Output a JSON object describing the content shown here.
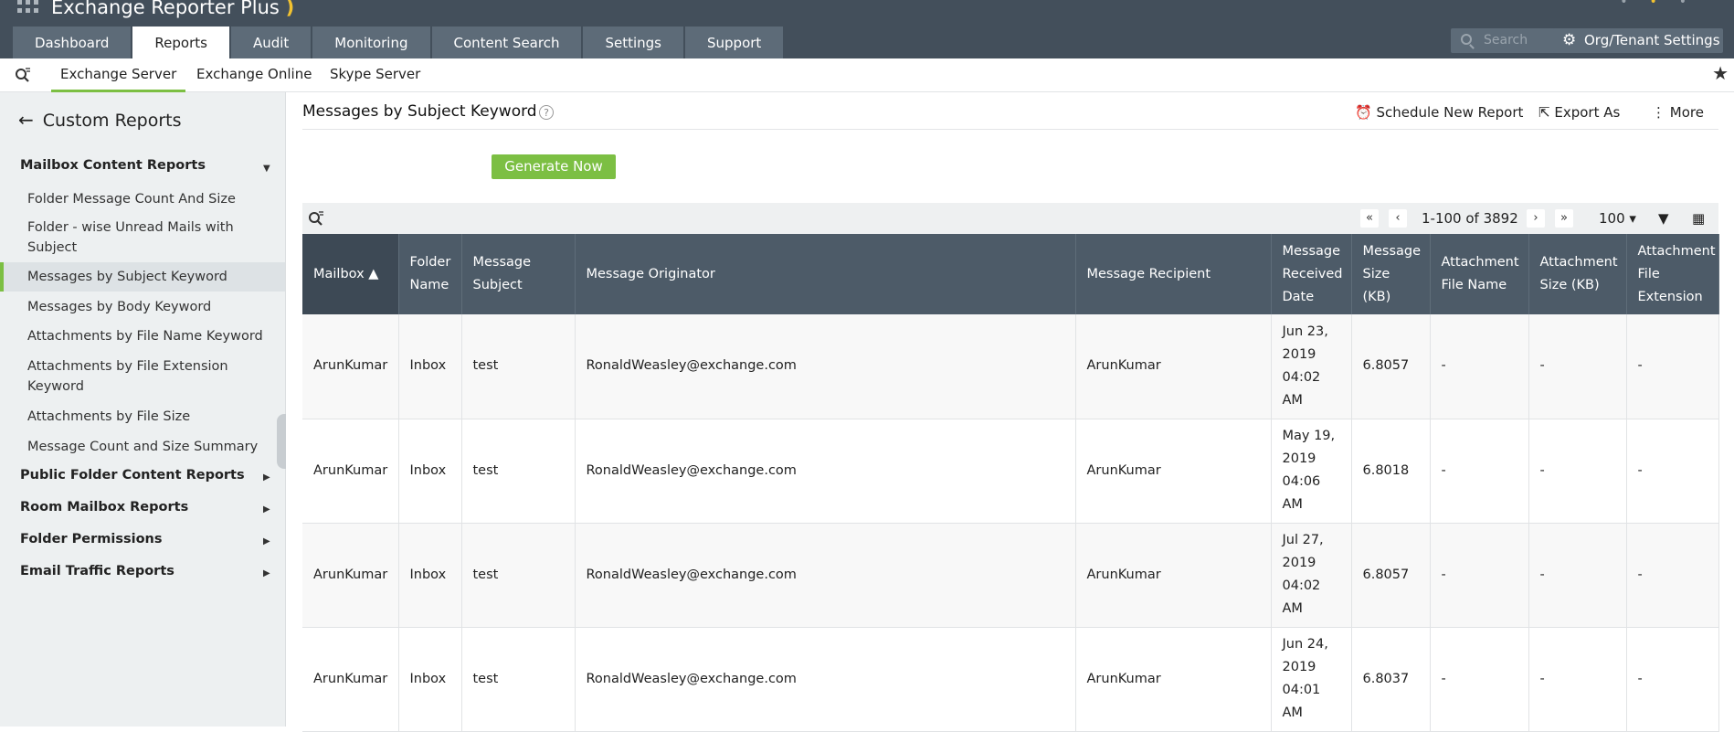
{
  "app": {
    "title": "Exchange Reporter Plus"
  },
  "top_tabs": [
    {
      "label": "Dashboard"
    },
    {
      "label": "Reports",
      "active": true
    },
    {
      "label": "Audit"
    },
    {
      "label": "Monitoring"
    },
    {
      "label": "Content Search"
    },
    {
      "label": "Settings"
    },
    {
      "label": "Support"
    }
  ],
  "header": {
    "search_placeholder": "Search",
    "org_settings_label": "Org/Tenant Settings"
  },
  "sub_tabs": [
    {
      "label": "Exchange Server",
      "active": true
    },
    {
      "label": "Exchange Online"
    },
    {
      "label": "Skype Server"
    }
  ],
  "sidebar": {
    "back_label": "Custom Reports",
    "category_expanded": "Mailbox Content Reports",
    "items": [
      {
        "label": "Folder Message Count And Size"
      },
      {
        "label": "Folder - wise Unread Mails with Subject"
      },
      {
        "label": "Messages by Subject Keyword",
        "active": true
      },
      {
        "label": "Messages by Body Keyword"
      },
      {
        "label": "Attachments by File Name Keyword"
      },
      {
        "label": "Attachments by File Extension Keyword"
      },
      {
        "label": "Attachments by File Size"
      },
      {
        "label": "Message Count and Size Summary"
      }
    ],
    "categories_collapsed": [
      {
        "label": "Public Folder Content Reports"
      },
      {
        "label": "Room Mailbox Reports"
      },
      {
        "label": "Folder Permissions"
      },
      {
        "label": "Email Traffic Reports"
      }
    ]
  },
  "report": {
    "title": "Messages by Subject Keyword",
    "actions": {
      "schedule": "Schedule New Report",
      "export": "Export As",
      "more": "More"
    },
    "generate_label": "Generate Now",
    "pager": {
      "range": "1-100 of 3892",
      "page_size": "100"
    },
    "columns": [
      "Mailbox",
      "Folder Name",
      "Message Subject",
      "Message Originator",
      "Message Recipient",
      "Message Received Date",
      "Message Size (KB)",
      "Attachment File Name",
      "Attachment Size (KB)",
      "Attachment File Extension"
    ],
    "rows": [
      [
        "ArunKumar",
        "Inbox",
        "test",
        "RonaldWeasley@exchange.com",
        "ArunKumar",
        "Jun 23, 2019 04:02 AM",
        "6.8057",
        "-",
        "-",
        "-"
      ],
      [
        "ArunKumar",
        "Inbox",
        "test",
        "RonaldWeasley@exchange.com",
        "ArunKumar",
        "May 19, 2019 04:06 AM",
        "6.8018",
        "-",
        "-",
        "-"
      ],
      [
        "ArunKumar",
        "Inbox",
        "test",
        "RonaldWeasley@exchange.com",
        "ArunKumar",
        "Jul 27, 2019 04:02 AM",
        "6.8057",
        "-",
        "-",
        "-"
      ],
      [
        "ArunKumar",
        "Inbox",
        "test",
        "RonaldWeasley@exchange.com",
        "ArunKumar",
        "Jun 24, 2019 04:01 AM",
        "6.8037",
        "-",
        "-",
        "-"
      ]
    ]
  },
  "colors": {
    "topbar": "#434f5b",
    "tab": "#5d6b78",
    "accent_green": "#7cbf43",
    "table_header": "#4d5b68"
  }
}
